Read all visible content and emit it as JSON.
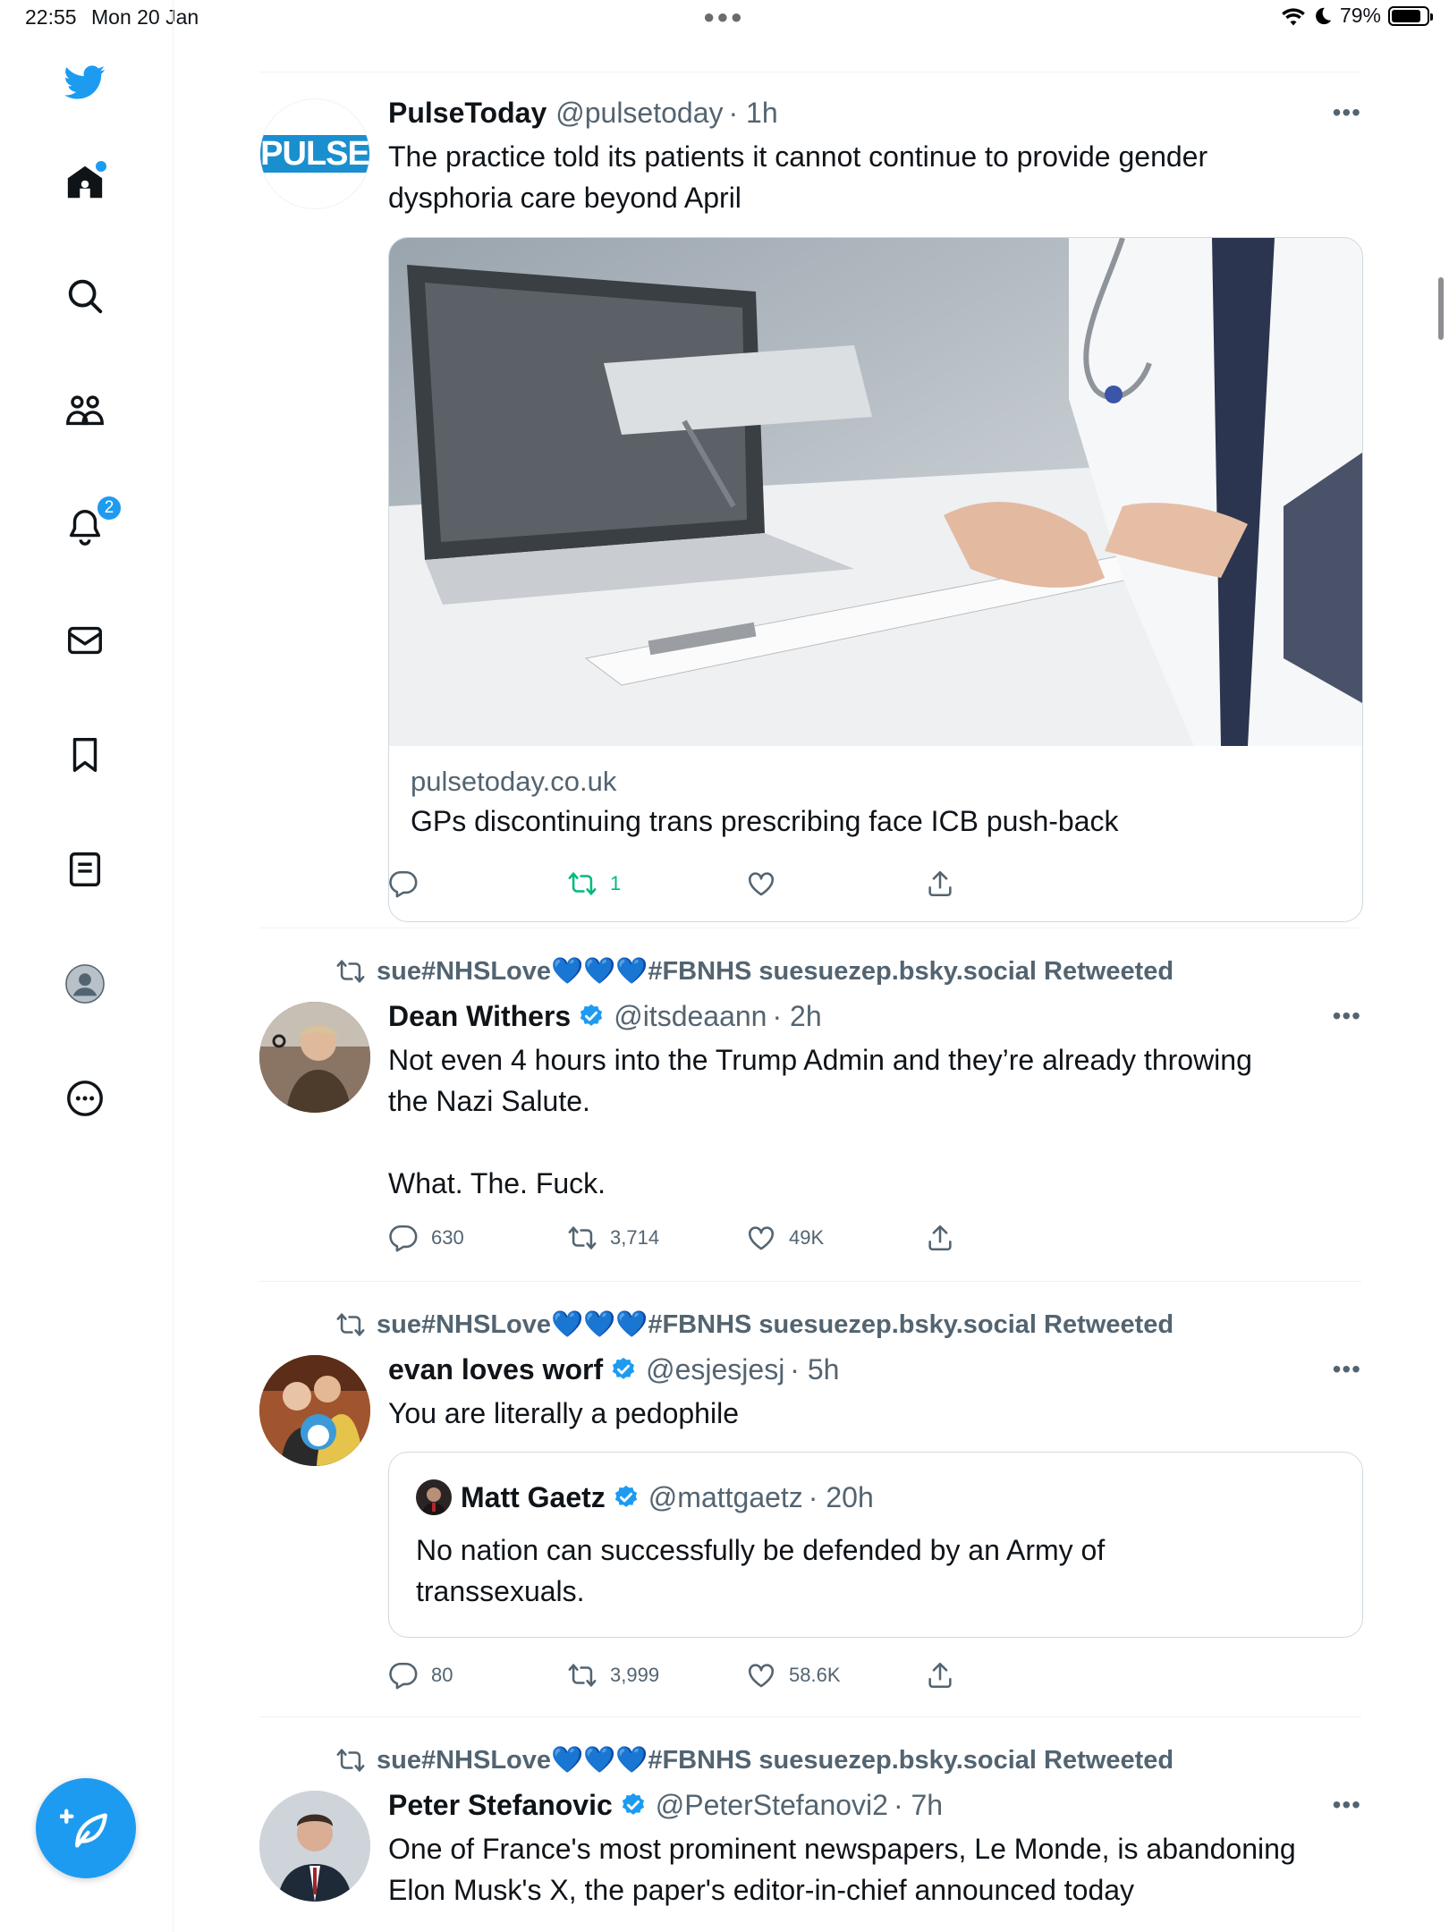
{
  "status_bar": {
    "time": "22:55",
    "date": "Mon 20 Jan",
    "battery": "79%"
  },
  "sidebar": {
    "notifications_badge": "2",
    "items": [
      "twitter-logo",
      "home",
      "search",
      "communities",
      "notifications",
      "messages",
      "bookmarks",
      "lists",
      "profile",
      "more"
    ]
  },
  "tweets": [
    {
      "name": "PulseToday",
      "handle": "@pulsetoday",
      "time": "· 1h",
      "avatar_text": "PULSE",
      "text": "The practice told its patients it cannot continue to provide gender\ndysphoria care beyond April",
      "card": {
        "domain": "pulsetoday.co.uk",
        "title": "GPs discontinuing trans prescribing face ICB push-back"
      },
      "replies": "",
      "retweets": "1",
      "likes": ""
    },
    {
      "retweeted_by": "sue#NHSLove💙💙💙#FBNHS suesuezep.bsky.social Retweeted",
      "name": "Dean Withers",
      "handle": "@itsdeaann",
      "time": "· 2h",
      "text": "Not even 4 hours into the Trump Admin and they’re already throwing\nthe Nazi Salute.\n\nWhat. The. Fuck.",
      "replies": "630",
      "retweets": "3,714",
      "likes": "49K"
    },
    {
      "retweeted_by": "sue#NHSLove💙💙💙#FBNHS suesuezep.bsky.social Retweeted",
      "name": "evan loves worf",
      "handle": "@esjesjesj",
      "time": "· 5h",
      "text": "You are literally a pedophile",
      "quote": {
        "name": "Matt Gaetz",
        "handle": "@mattgaetz",
        "time": "· 20h",
        "text": "No nation can successfully be defended by an Army of\ntranssexuals."
      },
      "replies": "80",
      "retweets": "3,999",
      "likes": "58.6K"
    },
    {
      "retweeted_by": "sue#NHSLove💙💙💙#FBNHS suesuezep.bsky.social Retweeted",
      "name": "Peter Stefanovic",
      "handle": "@PeterStefanovi2",
      "time": "· 7h",
      "text": "One of France's most prominent newspapers, Le Monde, is abandoning\nElon Musk's X, the paper's editor-in-chief announced today"
    }
  ],
  "colors": {
    "accent": "#1d9bf0",
    "retweet_active": "#00ba7c",
    "secondary_text": "#536471",
    "border": "#cfd9de"
  }
}
